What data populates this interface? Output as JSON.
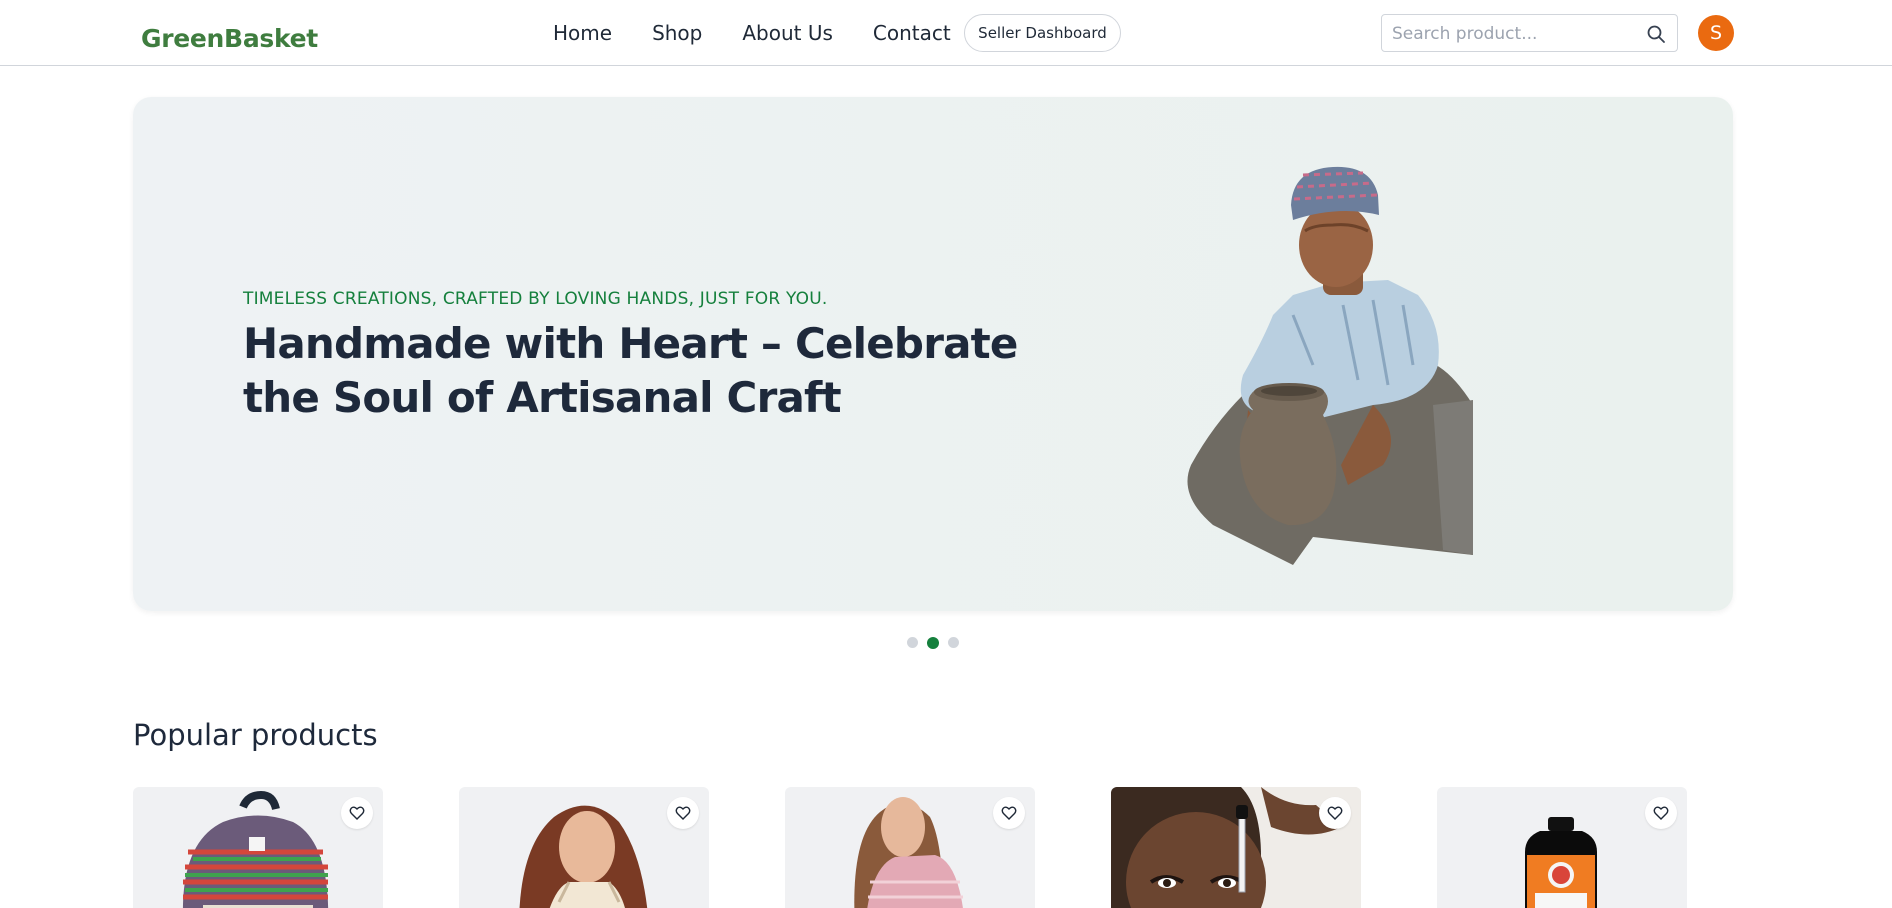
{
  "header": {
    "logo": "GreenBasket",
    "nav": [
      "Home",
      "Shop",
      "About Us",
      "Contact"
    ],
    "seller_button": "Seller Dashboard",
    "search_placeholder": "Search product...",
    "avatar_initial": "S",
    "avatar_color": "#ea6a10",
    "accent_color": "#15803d"
  },
  "hero": {
    "eyebrow": "TIMELESS CREATIONS, CRAFTED BY LOVING HANDS, JUST FOR YOU.",
    "title": "Handmade with Heart – Celebrate the Soul of Artisanal Craft",
    "slides_total": 3,
    "active_slide": 2
  },
  "products_section": {
    "title": "Popular products",
    "items": [
      {
        "icon": "backpack-image"
      },
      {
        "icon": "woman-dress-image"
      },
      {
        "icon": "woman-top-image"
      },
      {
        "icon": "face-serum-image"
      },
      {
        "icon": "hemp-oil-bottle-image"
      }
    ],
    "fav_icon": "heart-icon"
  }
}
